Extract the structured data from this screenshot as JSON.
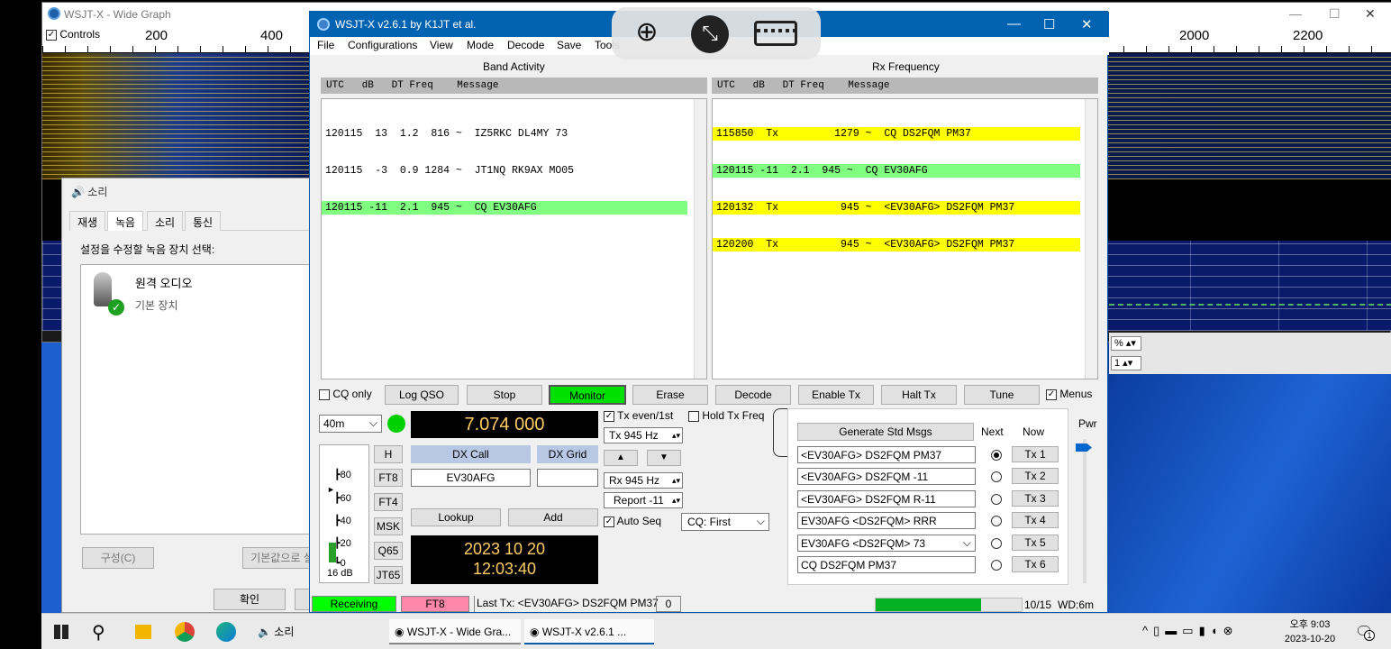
{
  "wide_graph": {
    "title": "WSJT-X - Wide Graph",
    "controls_label": "Controls",
    "freq_labels_left": [
      "200",
      "400"
    ],
    "freq_labels_right": [
      "2000",
      "2200"
    ],
    "spin1": "%",
    "spin2": "1"
  },
  "sound_dialog": {
    "title": "소리",
    "tabs": [
      "재생",
      "녹음",
      "소리",
      "통신"
    ],
    "selected_tab": "녹음",
    "hint": "설정을 수정할 녹음 장치 선택:",
    "device_name": "원격 오디오",
    "device_desc": "기본 장치",
    "configure_btn": "구성(C)",
    "default_btn": "기본값으로 설",
    "ok_btn": "확인"
  },
  "wsjtx": {
    "title": "WSJT-X   v2.6.1   by K1JT et al.",
    "menu": [
      "File",
      "Configurations",
      "View",
      "Mode",
      "Decode",
      "Save",
      "Tools"
    ],
    "band_activity": {
      "label": "Band Activity",
      "header": "UTC   dB   DT Freq    Message",
      "rows": [
        {
          "text": "120115  13  1.2  816 ~  IZ5RKC DL4MY 73",
          "style": ""
        },
        {
          "text": "120115  -3  0.9 1284 ~  JT1NQ RK9AX MO05",
          "style": ""
        },
        {
          "text": "120115 -11  2.1  945 ~  CQ EV30AFG",
          "style": "grn"
        }
      ]
    },
    "rx_frequency": {
      "label": "Rx Frequency",
      "header": "UTC   dB   DT Freq    Message",
      "rows": [
        {
          "text": "115850  Tx         1279 ~  CQ DS2FQM PM37",
          "style": "yel"
        },
        {
          "text": "120115 -11  2.1  945 ~  CQ EV30AFG",
          "style": "grn"
        },
        {
          "text": "120132  Tx          945 ~  <EV30AFG> DS2FQM PM37",
          "style": "yel"
        },
        {
          "text": "120200  Tx          945 ~  <EV30AFG> DS2FQM PM37",
          "style": "yel"
        }
      ]
    },
    "buttons": {
      "cq_only": "CQ only",
      "log_qso": "Log QSO",
      "stop": "Stop",
      "monitor": "Monitor",
      "erase": "Erase",
      "decode": "Decode",
      "enable_tx": "Enable Tx",
      "halt_tx": "Halt Tx",
      "tune": "Tune",
      "menus": "Menus"
    },
    "band": "40m",
    "frequency": "7.074 000",
    "tx_even": "Tx even/1st",
    "hold_tx": "Hold Tx Freq",
    "tx_hz": "Tx  945  Hz",
    "rx_hz": "Rx  945  Hz",
    "report": "Report -11",
    "auto_seq": "Auto Seq",
    "cq_first": "CQ: First",
    "mode_buttons": [
      "H",
      "FT8",
      "FT4",
      "MSK",
      "Q65",
      "JT65"
    ],
    "meter_labels": [
      "80",
      "60",
      "40",
      "20",
      "0"
    ],
    "meter_db": "16 dB",
    "dx_call_label": "DX Call",
    "dx_grid_label": "DX Grid",
    "dx_call": "EV30AFG",
    "dx_grid": "",
    "lookup": "Lookup",
    "add": "Add",
    "date": "2023 10 20",
    "time": "12:03:40",
    "gen_std": "Generate Std Msgs",
    "next_label": "Next",
    "now_label": "Now",
    "pwr_label": "Pwr",
    "tx_messages": [
      {
        "text": "<EV30AFG> DS2FQM PM37",
        "btn": "Tx 1",
        "selected": true
      },
      {
        "text": "<EV30AFG> DS2FQM -11",
        "btn": "Tx 2",
        "selected": false
      },
      {
        "text": "<EV30AFG> DS2FQM R-11",
        "btn": "Tx 3",
        "selected": false
      },
      {
        "text": "EV30AFG <DS2FQM> RRR",
        "btn": "Tx 4",
        "selected": false
      },
      {
        "text": "EV30AFG <DS2FQM> 73",
        "btn": "Tx 5",
        "selected": false
      },
      {
        "text": "CQ DS2FQM PM37",
        "btn": "Tx 6",
        "selected": false
      }
    ],
    "status": {
      "receiving": "Receiving",
      "mode": "FT8",
      "last_tx": "Last Tx: <EV30AFG> DS2FQM PM37",
      "count": "0",
      "progress": 0.72,
      "period": "10/15",
      "wd": "WD:6m"
    }
  },
  "taskbar": {
    "items": [
      "소리",
      "WSJT-X - Wide Gra...",
      "WSJT-X  v2.6.1  ..."
    ],
    "time": "오후 9:03",
    "date": "2023-10-20",
    "notif_count": "1"
  },
  "colors": {
    "titlebar": "#0063b1",
    "monitor": "#00e000",
    "receiving": "#00ff00",
    "mode_pink": "#ff88aa",
    "highlight_green": "#80ff80",
    "highlight_yellow": "#ffff00"
  }
}
